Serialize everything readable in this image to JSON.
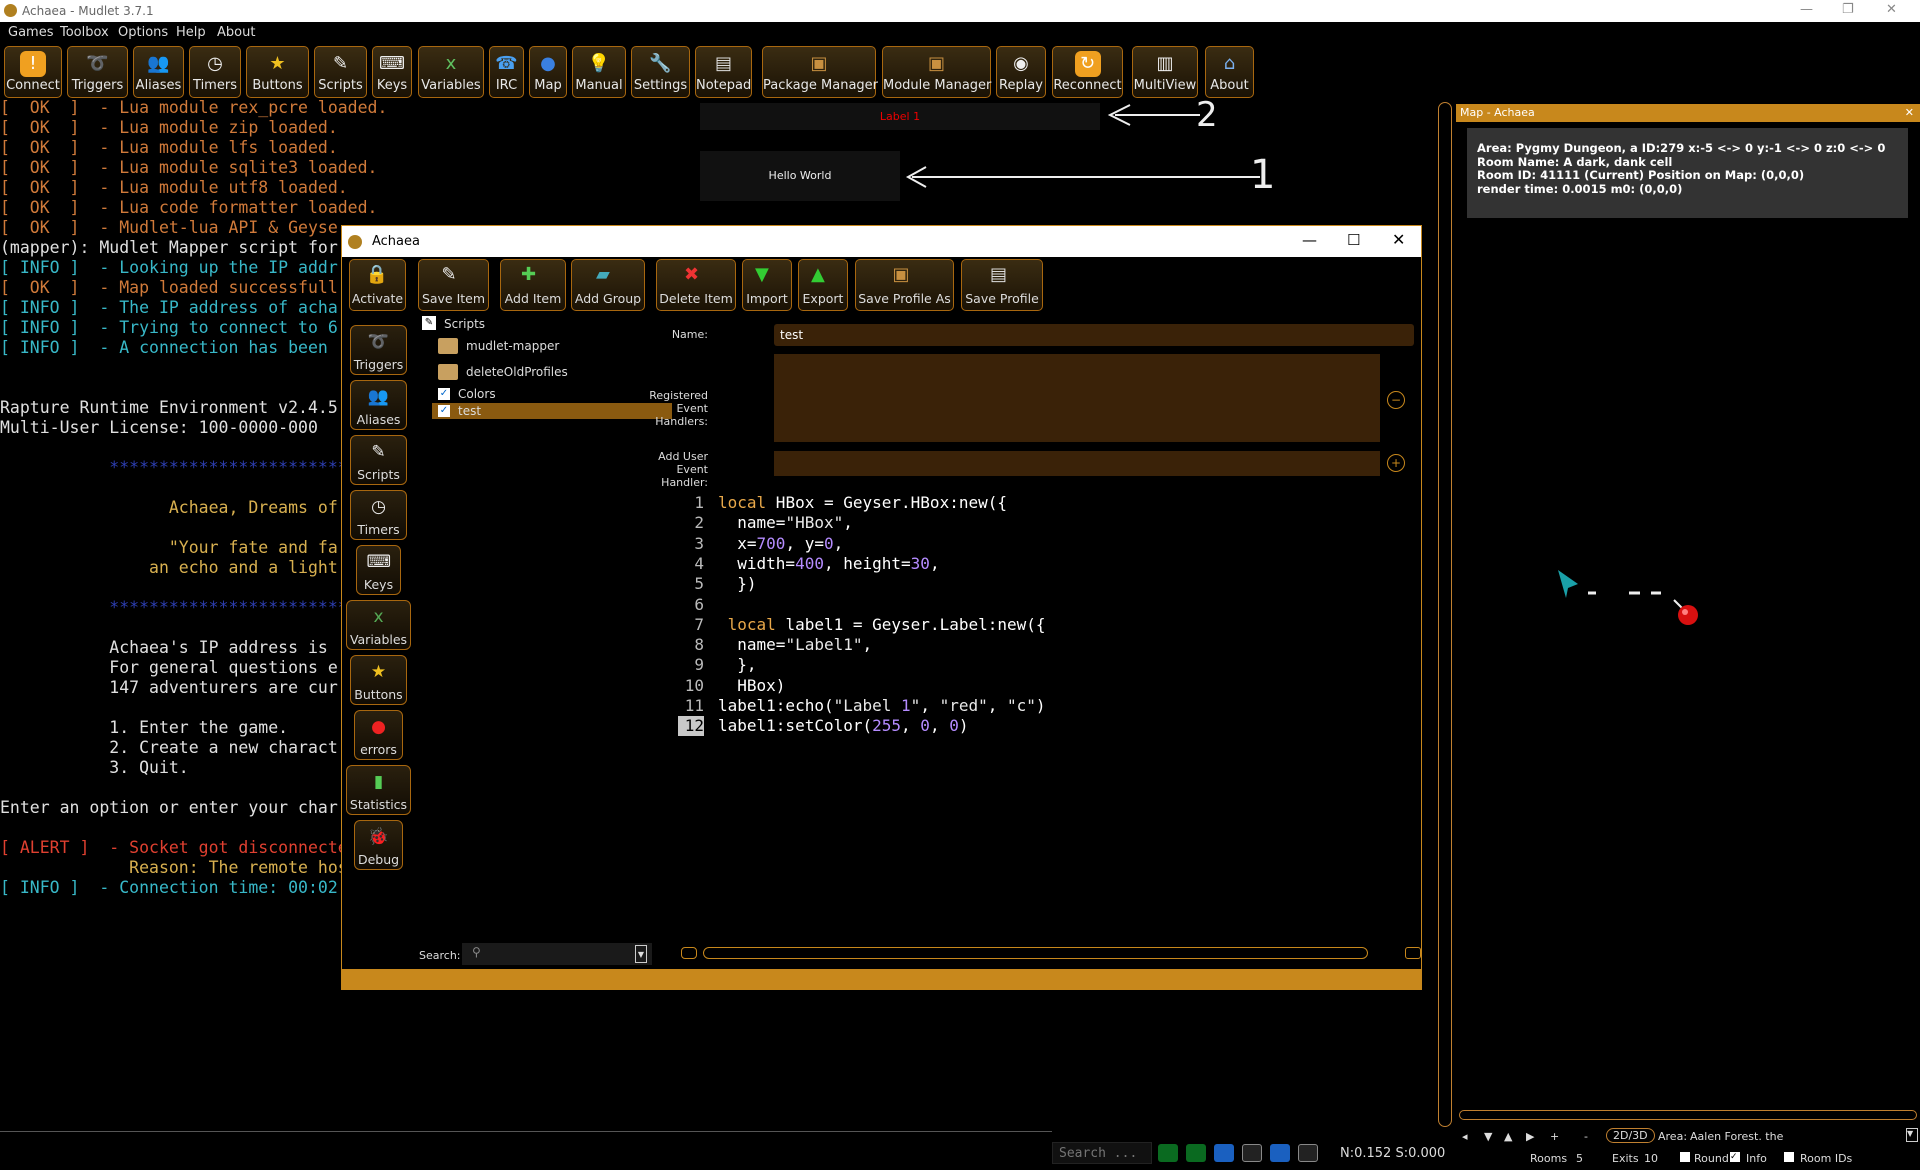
{
  "window": {
    "title": "Achaea - Mudlet 3.7.1"
  },
  "menu": [
    "Games",
    "Toolbox",
    "Options",
    "Help",
    "About"
  ],
  "toolbar": [
    "Connect",
    "Triggers",
    "Aliases",
    "Timers",
    "Buttons",
    "Scripts",
    "Keys",
    "Variables",
    "IRC",
    "Map",
    "Manual",
    "Settings",
    "Notepad",
    "Package Manager",
    "Module Manager",
    "Replay",
    "Reconnect",
    "MultiView",
    "About"
  ],
  "console": [
    {
      "t": "[  OK  ]  - Lua module rex_pcre loaded.",
      "c": "o"
    },
    {
      "t": "[  OK  ]  - Lua module zip loaded.",
      "c": "o"
    },
    {
      "t": "[  OK  ]  - Lua module lfs loaded.",
      "c": "o"
    },
    {
      "t": "[  OK  ]  - Lua module sqlite3 loaded.",
      "c": "o"
    },
    {
      "t": "[  OK  ]  - Lua module utf8 loaded.",
      "c": "o"
    },
    {
      "t": "[  OK  ]  - Lua code formatter loaded.",
      "c": "o"
    },
    {
      "t": "[  OK  ]  - Mudlet-lua API & Geyse",
      "c": "o"
    },
    {
      "t": "(mapper): Mudlet Mapper script for",
      "c": "w"
    },
    {
      "t": "[ INFO ]  - Looking up the IP addr",
      "c": "c"
    },
    {
      "t": "[  OK  ]  - Map loaded successfull",
      "c": "o"
    },
    {
      "t": "[ INFO ]  - The IP address of acha",
      "c": "c"
    },
    {
      "t": "[ INFO ]  - Trying to connect to 6",
      "c": "c"
    },
    {
      "t": "[ INFO ]  - A connection has been",
      "c": "c"
    },
    {
      "t": "",
      "c": "w"
    },
    {
      "t": "",
      "c": "w"
    },
    {
      "t": "Rapture Runtime Environment v2.4.5",
      "c": "w"
    },
    {
      "t": "Multi-User License: 100-0000-000",
      "c": "w"
    },
    {
      "t": "",
      "c": "w"
    },
    {
      "t": "           ****************************",
      "c": "b"
    },
    {
      "t": "",
      "c": "w"
    },
    {
      "t": "                 Achaea, Dreams of",
      "c": "y"
    },
    {
      "t": "",
      "c": "w"
    },
    {
      "t": "                 \"Your fate and fa",
      "c": "y"
    },
    {
      "t": "               an echo and a light",
      "c": "y"
    },
    {
      "t": "",
      "c": "w"
    },
    {
      "t": "           ****************************",
      "c": "b"
    },
    {
      "t": "",
      "c": "w"
    },
    {
      "t": "           Achaea's IP address is",
      "c": "w"
    },
    {
      "t": "           For general questions e",
      "c": "w"
    },
    {
      "t": "           147 adventurers are cur",
      "c": "w"
    },
    {
      "t": "",
      "c": "w"
    },
    {
      "t": "           1. Enter the game.",
      "c": "w"
    },
    {
      "t": "           2. Create a new charact",
      "c": "w"
    },
    {
      "t": "           3. Quit.",
      "c": "w"
    },
    {
      "t": "",
      "c": "w"
    },
    {
      "t": "Enter an option or enter your char",
      "c": "w"
    },
    {
      "t": "",
      "c": "w"
    },
    {
      "t": "[ ALERT ]  - Socket got disconnecte",
      "c": "r"
    },
    {
      "t": "             Reason: The remote hos",
      "c": "y"
    },
    {
      "t": "[ INFO ]  - Connection time: 00:02",
      "c": "c"
    }
  ],
  "labels": {
    "label1": "Label 1",
    "hello": "Hello World",
    "arrow2": "2",
    "arrow1": "1"
  },
  "map": {
    "title": "Map - Achaea",
    "info": [
      "Area: Pygmy Dungeon, a ID:279 x:-5 <-> 0 y:-1 <-> 0 z:0 <-> 0",
      "Room Name: A dark, dank cell",
      "Room ID: 41111 (Current) Position on Map: (0,0,0)",
      "render time: 0.0015 m0: (0,0,0)"
    ],
    "mode_btn": "2D/3D",
    "area_label": "Area:",
    "area_value": "Aalen Forest. the",
    "rooms_label": "Rooms",
    "rooms_value": "5",
    "exits_label": "Exits",
    "exits_value": "10",
    "round_label": "Round",
    "info_label": "Info",
    "roomids_label": "Room IDs"
  },
  "status": {
    "search_placeholder": "Search ...",
    "net": "N:0.152 S:0.000"
  },
  "editor": {
    "title": "Achaea",
    "toolbar": [
      "Activate",
      "Save Item",
      "Add Item",
      "Add Group",
      "Delete Item",
      "Import",
      "Export",
      "Save Profile As",
      "Save Profile"
    ],
    "sidebar": [
      "Triggers",
      "Aliases",
      "Scripts",
      "Timers",
      "Keys",
      "Variables",
      "Buttons",
      "errors",
      "Statistics",
      "Debug"
    ],
    "tree": {
      "root": "Scripts",
      "items": [
        "mudlet-mapper",
        "deleteOldProfiles",
        "Colors",
        "test"
      ]
    },
    "name_label": "Name:",
    "name_value": "test",
    "reh_label": "Registered Event Handlers:",
    "aueh_label": "Add User Event Handler:",
    "search_label": "Search:",
    "code": [
      "local HBox = Geyser.HBox:new({",
      "  name=\"HBox\",",
      "  x=700, y=0,",
      "  width=400, height=30,",
      "  })",
      "",
      " local label1 = Geyser.Label:new({",
      "  name=\"Label1\",",
      "  },",
      "  HBox)",
      "label1:echo(\"Label 1\", \"red\", \"c\")",
      "label1:setColor(255, 0, 0)"
    ]
  }
}
